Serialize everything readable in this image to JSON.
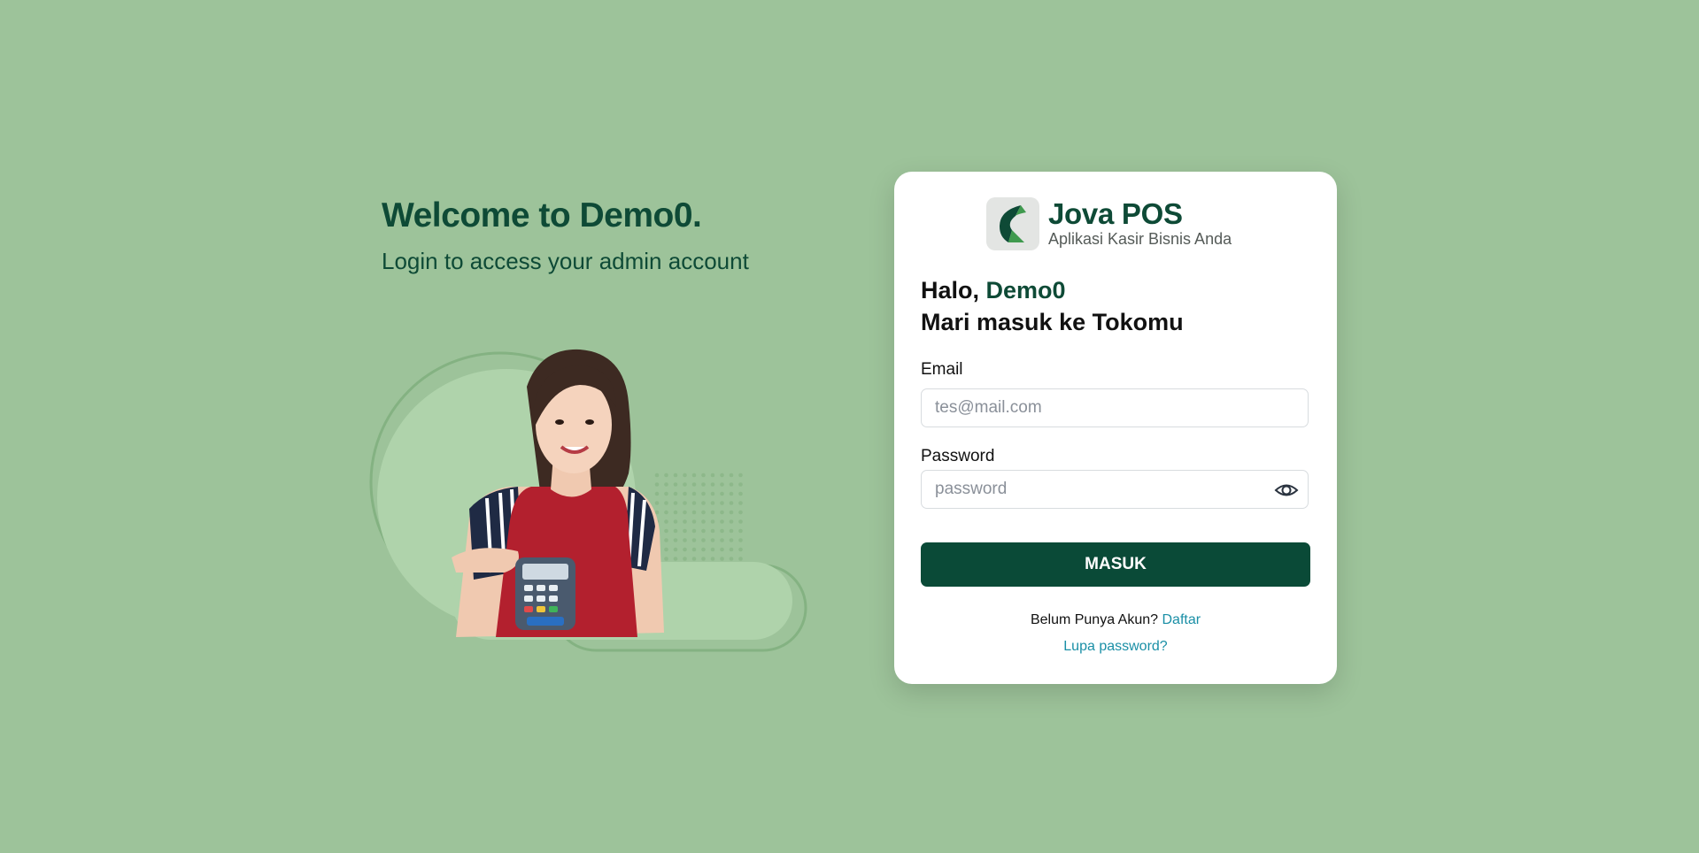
{
  "welcome": {
    "title": "Welcome to Demo0.",
    "subtitle": "Login to access your admin account"
  },
  "brand": {
    "name": "Jova POS",
    "tagline": "Aplikasi Kasir Bisnis Anda"
  },
  "greeting": {
    "hello": "Halo, ",
    "store_name": "Demo0",
    "line2": "Mari masuk ke Tokomu"
  },
  "form": {
    "email_label": "Email",
    "email_placeholder": "tes@mail.com",
    "email_value": "",
    "password_label": "Password",
    "password_placeholder": "password",
    "password_value": "",
    "submit_label": "MASUK"
  },
  "footer": {
    "signup_prompt": "Belum Punya Akun?",
    "signup_link": "Daftar",
    "forgot_link": "Lupa password?"
  },
  "colors": {
    "background": "#9dc39a",
    "primary": "#0a4a37",
    "link": "#1a8fa6",
    "card": "#ffffff"
  },
  "icons": {
    "password_toggle": "eye-icon",
    "brand": "jova-logo-icon"
  }
}
